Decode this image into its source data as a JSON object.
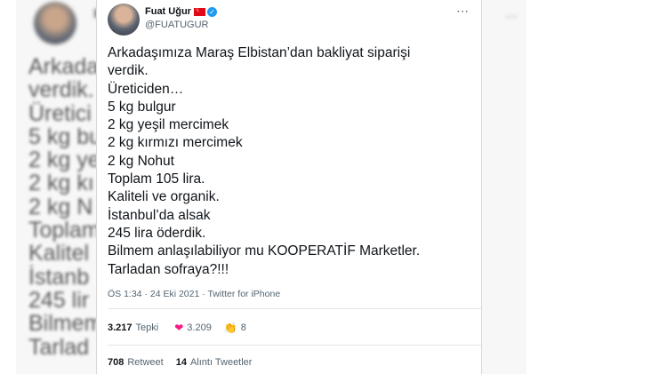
{
  "background": {
    "blurred_lines": [
      "Arkada",
      "verdik.",
      "Üretici",
      "5 kg bu",
      "2 kg ye",
      "2 kg kı",
      "2 kg N",
      "Toplam",
      "Kalitel",
      "İstanb",
      "245 lir",
      "Bilmem",
      "Tarlad"
    ]
  },
  "tweet": {
    "author_name": "Fuat Uğur",
    "handle": "@FUATUGUR",
    "more_icon": "⋯",
    "lines": [
      "Arkadaşımıza Maraş Elbistan’dan bakliyat siparişi",
      "verdik.",
      "Üreticiden…",
      "5 kg bulgur",
      "2 kg yeşil mercimek",
      "2 kg kırmızı mercimek",
      "2 kg Nohut",
      "Toplam 105 lira.",
      "Kaliteli ve organik.",
      "İstanbul’da alsak",
      "245 lira öderdik.",
      "Bilmem anlaşılabiliyor mu KOOPERATİF Marketler.",
      "Tarladan sofraya?!!!"
    ],
    "meta": "ÖS 1:34 · 24 Eki 2021 · Twitter for iPhone",
    "reactions": {
      "total_count": "3.217",
      "total_label": "Tepki",
      "heart_count": "3.209",
      "clap_count": "8"
    },
    "retweets": {
      "count": "708",
      "label": "Retweet"
    },
    "quotes": {
      "count": "14",
      "label": "Alıntı Tweetler"
    }
  },
  "colors": {
    "verified": "#1d9bf0",
    "heart": "#f91880",
    "flag": "#e30a17"
  }
}
